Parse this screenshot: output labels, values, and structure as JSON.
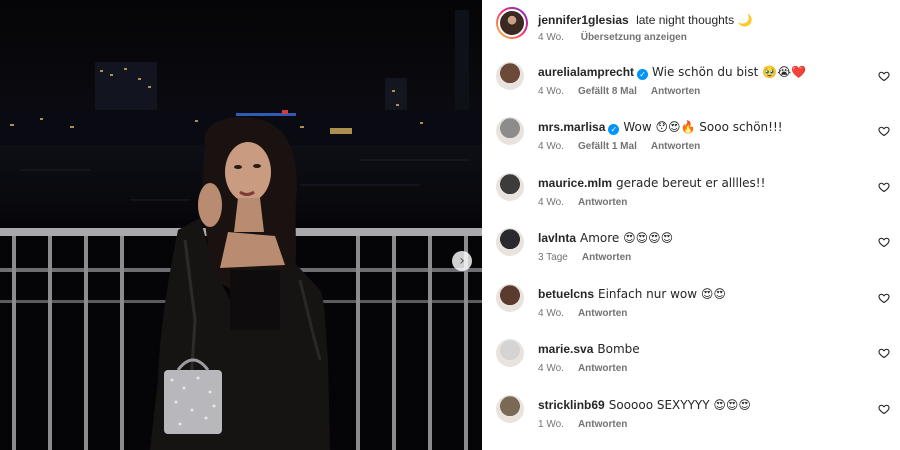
{
  "post": {
    "author": "jennifer1glesias",
    "caption": "late night thoughts 🌙",
    "age": "4 Wo.",
    "translate_label": "Übersetzung anzeigen"
  },
  "comments": [
    {
      "username": "aurelialamprecht",
      "verified": true,
      "text": "Wie schön du bist 🥹😭❤️",
      "age": "4 Wo.",
      "likes": "Gefällt 8 Mal",
      "reply": "Antworten",
      "avatar": "#6b4a3a"
    },
    {
      "username": "mrs.marlisa",
      "verified": true,
      "text": "Wow 😯😍🔥 Sooo schön!!!",
      "age": "4 Wo.",
      "likes": "Gefällt 1 Mal",
      "reply": "Antworten",
      "avatar": "#8c8c8c"
    },
    {
      "username": "maurice.mlm",
      "verified": false,
      "text": "gerade bereut er alllles!!",
      "age": "4 Wo.",
      "likes": "",
      "reply": "Antworten",
      "avatar": "#3c3c3c"
    },
    {
      "username": "lavlnta",
      "verified": false,
      "text": "Amore 😍😍😍😍",
      "age": "3 Tage",
      "likes": "",
      "reply": "Antworten",
      "avatar": "#2a2a2e"
    },
    {
      "username": "betuelcns",
      "verified": false,
      "text": "Einfach nur wow 😍😍",
      "age": "4 Wo.",
      "likes": "",
      "reply": "Antworten",
      "avatar": "#5a3b2e"
    },
    {
      "username": "marie.sva",
      "verified": false,
      "text": "Bombe",
      "age": "4 Wo.",
      "likes": "",
      "reply": "Antworten",
      "avatar": "#d4d4d4"
    },
    {
      "username": "stricklinb69",
      "verified": false,
      "text": "Sooooo SEXYYYY 😍😍😍",
      "age": "1 Wo.",
      "likes": "",
      "reply": "Antworten",
      "avatar": "#7a6a55"
    }
  ],
  "icons": {
    "verified": "verified-badge-icon",
    "like": "heart-outline-icon",
    "next": "chevron-right-icon"
  },
  "colors": {
    "verified": "#0095f6",
    "meta": "#737373"
  }
}
